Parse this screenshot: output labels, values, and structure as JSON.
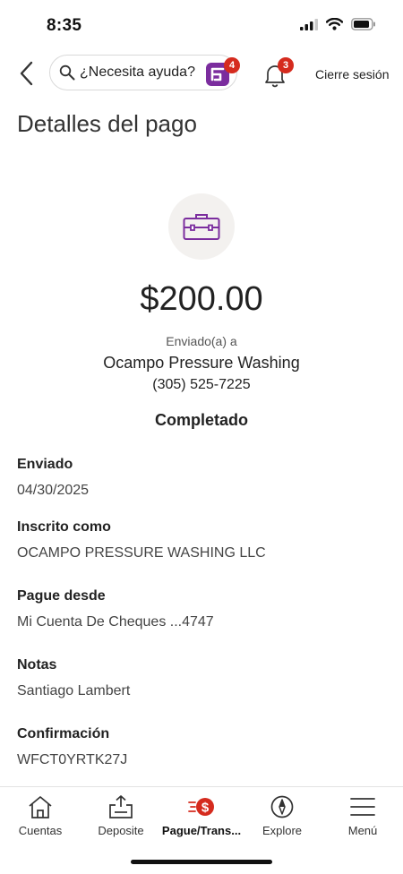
{
  "status_bar": {
    "time": "8:35"
  },
  "header": {
    "search_placeholder": "¿Necesita ayuda?",
    "assistant_badge": "4",
    "notifications_badge": "3",
    "signout_label": "Cierre sesión"
  },
  "page_title": "Detalles del pago",
  "payment": {
    "amount": "$200.00",
    "sent_to_label": "Enviado(a) a",
    "payee": "Ocampo Pressure Washing",
    "phone": "(305) 525-7225",
    "status": "Completado"
  },
  "details": [
    {
      "label": "Enviado",
      "value": "04/30/2025"
    },
    {
      "label": "Inscrito como",
      "value": "OCAMPO PRESSURE WASHING LLC"
    },
    {
      "label": "Pague desde",
      "value": "Mi Cuenta De Cheques ...4747"
    },
    {
      "label": "Notas",
      "value": "Santiago Lambert"
    },
    {
      "label": "Confirmación",
      "value": "WFCT0YRTK27J"
    }
  ],
  "nav": [
    {
      "label": "Cuentas",
      "icon": "home-icon"
    },
    {
      "label": "Deposite",
      "icon": "deposit-icon"
    },
    {
      "label": "Pague/Trans...",
      "icon": "pay-transfer-icon",
      "active": true
    },
    {
      "label": "Explore",
      "icon": "compass-icon"
    },
    {
      "label": "Menú",
      "icon": "menu-icon"
    }
  ],
  "colors": {
    "brand_red": "#d52b1e",
    "accent_purple": "#7b2d9e"
  }
}
